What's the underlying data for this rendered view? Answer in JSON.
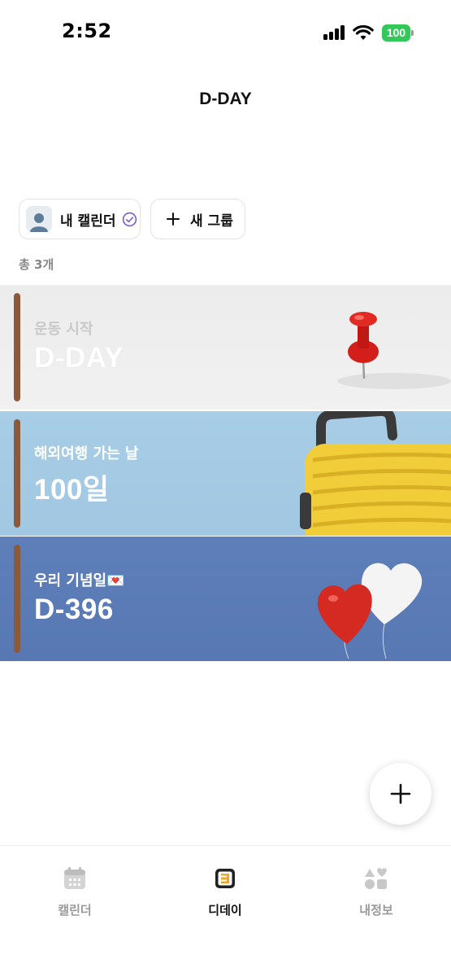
{
  "status_bar": {
    "time": "2:52",
    "battery": "100"
  },
  "header": {
    "title": "D-DAY"
  },
  "chips": {
    "my_calendar": "내 캘린더",
    "new_group": "새 그룹"
  },
  "total_count": "총 3개",
  "cards": [
    {
      "title": "운동 시작",
      "value": "D-DAY"
    },
    {
      "title": "해외여행 가는 날",
      "value": "100일"
    },
    {
      "title": "우리 기념일💌",
      "value": "D-396"
    }
  ],
  "tabs": [
    {
      "label": "캘린더",
      "icon": "calendar-icon",
      "active": false
    },
    {
      "label": "디데이",
      "icon": "dday-list-icon",
      "active": true
    },
    {
      "label": "내정보",
      "icon": "shapes-icon",
      "active": false
    }
  ],
  "colors": {
    "accent_purple": "#7b5cd6",
    "card_bar": "#8b5a3c",
    "battery_green": "#34c759"
  }
}
